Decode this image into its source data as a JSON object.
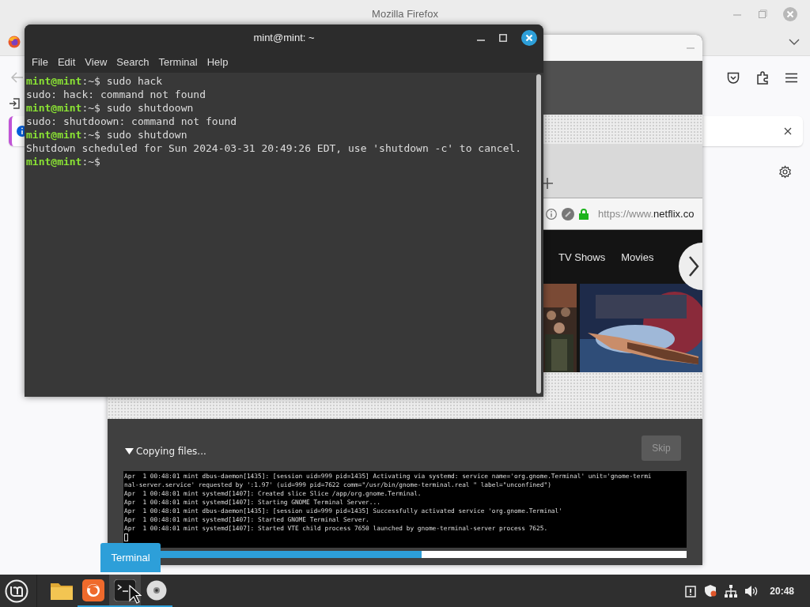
{
  "browser_window": {
    "title": "Mozilla Firefox"
  },
  "installer_window": {
    "slideshow": {
      "url_prefix": "https://www.",
      "url_host": "netflix.co",
      "nav": [
        "TV Shows",
        "Movies"
      ]
    },
    "expander": {
      "label": "Copying files...",
      "expanded": true
    },
    "skip_button": {
      "label": "Skip",
      "disabled": true
    },
    "log_lines": [
      "Apr  1 00:48:01 mint dbus-daemon[1435]: [session uid=999 pid=1435] Activating via systemd: service name='org.gnome.Terminal' unit='gnome-termi",
      "nal-server.service' requested by ':1.97' (uid=999 pid=7622 comm=\"/usr/bin/gnome-terminal.real \" label=\"unconfined\")",
      "Apr  1 00:48:01 mint systemd[1407]: Created slice Slice /app/org.gnome.Terminal.",
      "Apr  1 00:48:01 mint systemd[1407]: Starting GNOME Terminal Server...",
      "Apr  1 00:48:01 mint dbus-daemon[1435]: [session uid=999 pid=1435] Successfully activated service 'org.gnome.Terminal'",
      "Apr  1 00:48:01 mint systemd[1407]: Started GNOME Terminal Server.",
      "Apr  1 00:48:01 mint systemd[1407]: Started VTE child process 7650 launched by gnome-terminal-server process 7625."
    ],
    "progress": {
      "level": 0.53
    }
  },
  "terminal_window": {
    "title": "mint@mint: ~",
    "menu": [
      "File",
      "Edit",
      "View",
      "Search",
      "Terminal",
      "Help"
    ],
    "lines": [
      {
        "kind": "prompt",
        "user": "mint@mint",
        "text": ":~$ sudo hack"
      },
      {
        "kind": "output",
        "text": "sudo: hack: command not found"
      },
      {
        "kind": "prompt",
        "user": "mint@mint",
        "text": ":~$ sudo shutdoown"
      },
      {
        "kind": "output",
        "text": "sudo: shutdoown: command not found"
      },
      {
        "kind": "prompt",
        "user": "mint@mint",
        "text": ":~$ sudo shutdown"
      },
      {
        "kind": "output",
        "text": "Shutdown scheduled for Sun 2024-03-31 20:49:26 EDT, use 'shutdown -c' to cancel."
      },
      {
        "kind": "prompt",
        "user": "mint@mint",
        "text": ":~$"
      }
    ]
  },
  "tooltip": "Terminal",
  "taskbar": {
    "apps": [
      {
        "kind": "files",
        "running": false,
        "selected": false
      },
      {
        "kind": "firefox",
        "running": true,
        "selected": false
      },
      {
        "kind": "terminal",
        "running": true,
        "selected": true
      },
      {
        "kind": "disc",
        "running": true,
        "selected": false
      }
    ],
    "clock": "20:48"
  }
}
